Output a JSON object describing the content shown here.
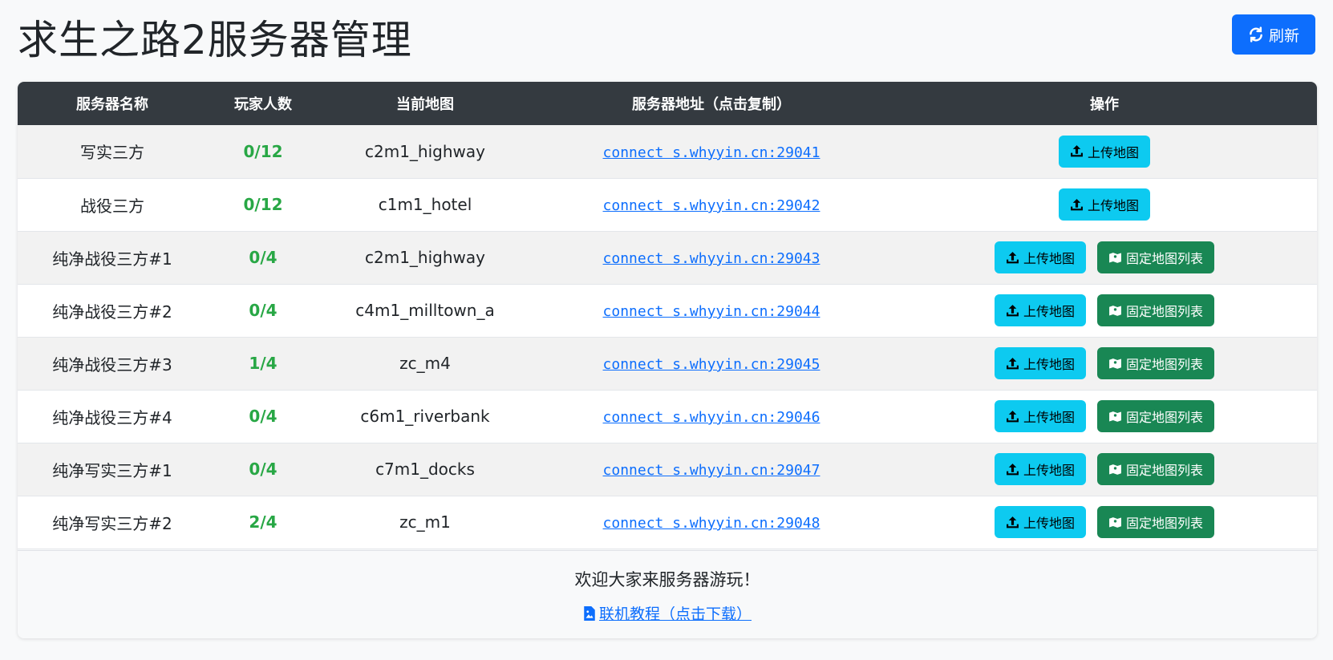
{
  "header": {
    "title": "求生之路2服务器管理",
    "refresh_label": "刷新"
  },
  "table": {
    "columns": [
      "服务器名称",
      "玩家人数",
      "当前地图",
      "服务器地址（点击复制）",
      "操作"
    ],
    "rows": [
      {
        "name": "写实三方",
        "players": "0/12",
        "map": "c2m1_highway",
        "address": "connect s.whyyin.cn:29041",
        "fixed": false
      },
      {
        "name": "战役三方",
        "players": "0/12",
        "map": "c1m1_hotel",
        "address": "connect s.whyyin.cn:29042",
        "fixed": false
      },
      {
        "name": "纯净战役三方#1",
        "players": "0/4",
        "map": "c2m1_highway",
        "address": "connect s.whyyin.cn:29043",
        "fixed": true
      },
      {
        "name": "纯净战役三方#2",
        "players": "0/4",
        "map": "c4m1_milltown_a",
        "address": "connect s.whyyin.cn:29044",
        "fixed": true
      },
      {
        "name": "纯净战役三方#3",
        "players": "1/4",
        "map": "zc_m4",
        "address": "connect s.whyyin.cn:29045",
        "fixed": true
      },
      {
        "name": "纯净战役三方#4",
        "players": "0/4",
        "map": "c6m1_riverbank",
        "address": "connect s.whyyin.cn:29046",
        "fixed": true
      },
      {
        "name": "纯净写实三方#1",
        "players": "0/4",
        "map": "c7m1_docks",
        "address": "connect s.whyyin.cn:29047",
        "fixed": true
      },
      {
        "name": "纯净写实三方#2",
        "players": "2/4",
        "map": "zc_m1",
        "address": "connect s.whyyin.cn:29048",
        "fixed": true
      }
    ],
    "upload_label": "上传地图",
    "fixed_label": "固定地图列表"
  },
  "footer": {
    "welcome": "欢迎大家来服务器游玩！",
    "tutorial_label": "联机教程（点击下载）"
  },
  "colors": {
    "primary": "#0d6efd",
    "info": "#0dcaf0",
    "success": "#198754",
    "players_green": "#28a745",
    "header_dark": "#343a40"
  },
  "icons": {
    "refresh": "refresh-icon",
    "upload": "upload-icon",
    "map": "map-icon",
    "file": "file-image-icon"
  }
}
